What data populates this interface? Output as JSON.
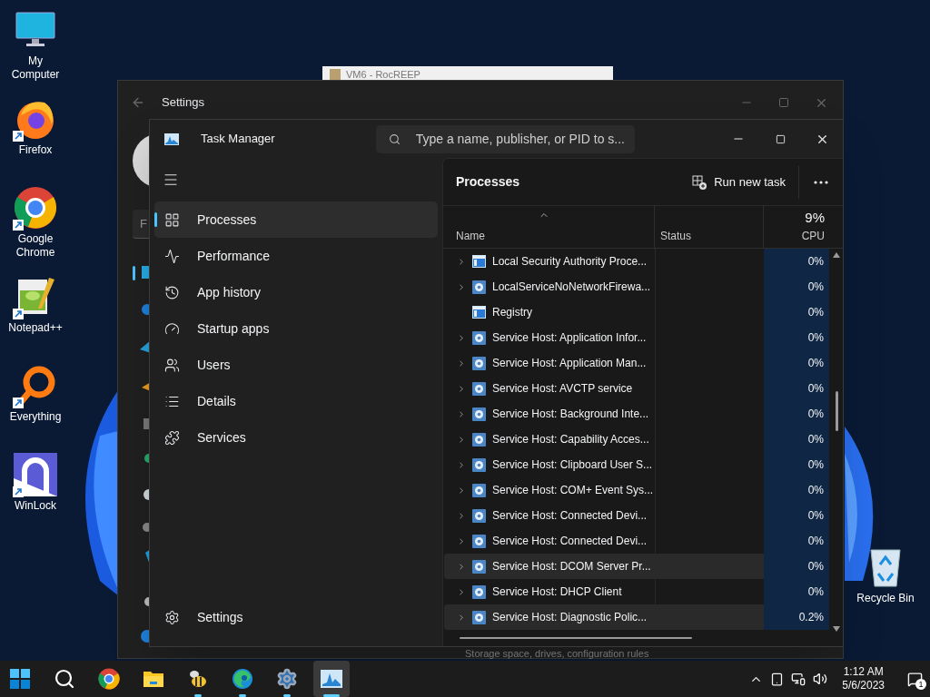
{
  "desktop_icons": [
    {
      "label": "My Computer",
      "kind": "monitor",
      "shortcut": false
    },
    {
      "label": "Firefox",
      "kind": "firefox",
      "shortcut": true
    },
    {
      "label": "Google Chrome",
      "kind": "chrome",
      "shortcut": true
    },
    {
      "label": "Notepad++",
      "kind": "notepad",
      "shortcut": true
    },
    {
      "label": "Everything",
      "kind": "everything",
      "shortcut": true
    },
    {
      "label": "WinLock",
      "kind": "winlock",
      "shortcut": true
    }
  ],
  "recycle_bin": {
    "label": "Recycle Bin"
  },
  "background_window": {
    "title": "VM6 - RocREEP"
  },
  "settings_window": {
    "title": "Settings",
    "search_text": "F",
    "footer_text": "Storage space, drives, configuration rules"
  },
  "task_manager": {
    "title": "Task Manager",
    "search": {
      "placeholder": "Type a name, publisher, or PID to s..."
    },
    "nav": [
      {
        "label": "Processes",
        "kind": "processes",
        "selected": true
      },
      {
        "label": "Performance",
        "kind": "performance",
        "selected": false
      },
      {
        "label": "App history",
        "kind": "history",
        "selected": false
      },
      {
        "label": "Startup apps",
        "kind": "startup",
        "selected": false
      },
      {
        "label": "Users",
        "kind": "users",
        "selected": false
      },
      {
        "label": "Details",
        "kind": "details",
        "selected": false
      },
      {
        "label": "Services",
        "kind": "services",
        "selected": false
      }
    ],
    "nav_footer": "Settings",
    "page_title": "Processes",
    "run_new_task": "Run new task",
    "columns": {
      "name": "Name",
      "status": "Status",
      "cpu_total": "9%",
      "cpu": "CPU"
    },
    "rows": [
      {
        "name": "Local Security Authority Proce...",
        "kind": "app",
        "expandable": true,
        "cpu": "0%",
        "highlighted": false
      },
      {
        "name": "LocalServiceNoNetworkFirewa...",
        "kind": "service",
        "expandable": true,
        "cpu": "0%",
        "highlighted": false
      },
      {
        "name": "Registry",
        "kind": "app",
        "expandable": false,
        "cpu": "0%",
        "highlighted": false
      },
      {
        "name": "Service Host: Application Infor...",
        "kind": "service",
        "expandable": true,
        "cpu": "0%",
        "highlighted": false
      },
      {
        "name": "Service Host: Application Man...",
        "kind": "service",
        "expandable": true,
        "cpu": "0%",
        "highlighted": false
      },
      {
        "name": "Service Host: AVCTP service",
        "kind": "service",
        "expandable": true,
        "cpu": "0%",
        "highlighted": false
      },
      {
        "name": "Service Host: Background Inte...",
        "kind": "service",
        "expandable": true,
        "cpu": "0%",
        "highlighted": false
      },
      {
        "name": "Service Host: Capability Acces...",
        "kind": "service",
        "expandable": true,
        "cpu": "0%",
        "highlighted": false
      },
      {
        "name": "Service Host: Clipboard User S...",
        "kind": "service",
        "expandable": true,
        "cpu": "0%",
        "highlighted": false
      },
      {
        "name": "Service Host: COM+ Event Sys...",
        "kind": "service",
        "expandable": true,
        "cpu": "0%",
        "highlighted": false
      },
      {
        "name": "Service Host: Connected Devi...",
        "kind": "service",
        "expandable": true,
        "cpu": "0%",
        "highlighted": false
      },
      {
        "name": "Service Host: Connected Devi...",
        "kind": "service",
        "expandable": true,
        "cpu": "0%",
        "highlighted": false
      },
      {
        "name": "Service Host: DCOM Server Pr...",
        "kind": "service",
        "expandable": true,
        "cpu": "0%",
        "highlighted": true
      },
      {
        "name": "Service Host: DHCP Client",
        "kind": "service",
        "expandable": true,
        "cpu": "0%",
        "highlighted": false
      },
      {
        "name": "Service Host: Diagnostic Polic...",
        "kind": "service",
        "expandable": true,
        "cpu": "0.2%",
        "highlighted": true
      }
    ]
  },
  "taskbar": {
    "apps": [
      {
        "kind": "start",
        "running": false,
        "active": false
      },
      {
        "kind": "search",
        "running": false,
        "active": false
      },
      {
        "kind": "chrome",
        "running": false,
        "active": false
      },
      {
        "kind": "explorer",
        "running": false,
        "active": false
      },
      {
        "kind": "bee",
        "running": true,
        "active": false
      },
      {
        "kind": "edge",
        "running": true,
        "active": false
      },
      {
        "kind": "settings",
        "running": true,
        "active": false
      },
      {
        "kind": "taskmanager",
        "running": true,
        "active": true
      }
    ],
    "time": "1:12 AM",
    "date": "5/6/2023",
    "notification_count": "1"
  }
}
